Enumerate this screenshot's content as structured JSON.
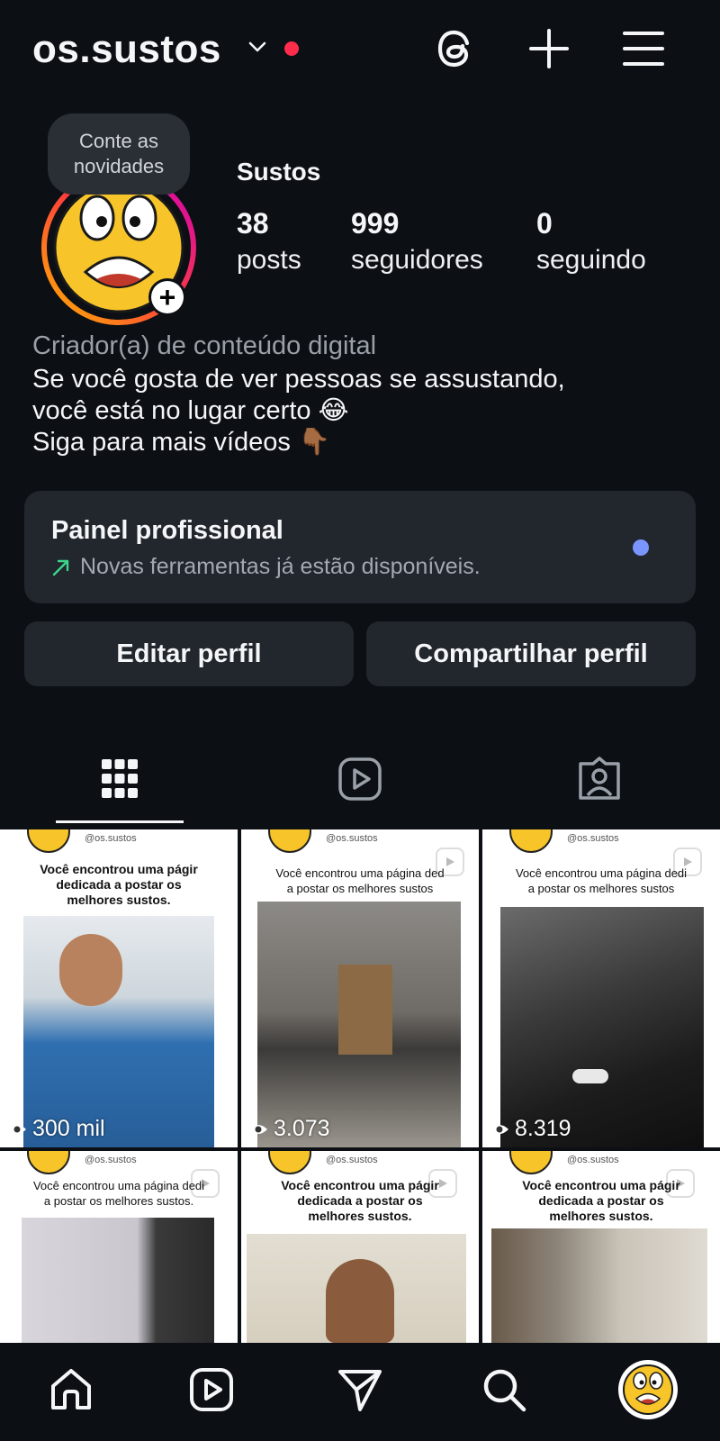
{
  "header": {
    "username": "os.sustos",
    "icons": [
      "threads-icon",
      "plus-icon",
      "menu-icon"
    ]
  },
  "profile": {
    "note": [
      "Conte as",
      "novidades"
    ],
    "name": "Sustos",
    "stats": [
      {
        "value": "38",
        "label": "posts"
      },
      {
        "value": "999",
        "label": "seguidores"
      },
      {
        "value": "0",
        "label": "seguindo"
      }
    ],
    "category": "Criador(a) de conteúdo digital",
    "bio": [
      "Se você gosta de ver pessoas se assustando,",
      "você está no lugar certo 😂",
      "Siga para mais vídeos 👇🏾"
    ]
  },
  "painel": {
    "title": "Painel profissional",
    "subtitle": "Novas ferramentas já estão disponíveis."
  },
  "buttons": {
    "edit": "Editar perfil",
    "share": "Compartilhar perfil"
  },
  "tabs": [
    "grid-icon",
    "reels-icon",
    "tagged-icon"
  ],
  "grid": {
    "handle": "@os.sustos",
    "posts": [
      {
        "caption": [
          "Você encontrou uma págir",
          "dedicada a postar os",
          "melhores sustos."
        ],
        "views": "300 mil"
      },
      {
        "caption": [
          "Você encontrou uma página ded",
          "a postar os melhores sustos"
        ],
        "views": "3.073"
      },
      {
        "caption": [
          "Você encontrou uma página dedi",
          "a postar os melhores sustos"
        ],
        "views": "8.319"
      },
      {
        "caption": [
          "Você encontrou uma página dedi",
          "a postar os melhores sustos."
        ],
        "views": ""
      },
      {
        "caption": [
          "Você encontrou uma págir",
          "dedicada a postar os",
          "melhores sustos."
        ],
        "views": ""
      },
      {
        "caption": [
          "Você encontrou uma págir",
          "dedicada a postar os",
          "melhores sustos."
        ],
        "views": ""
      }
    ]
  },
  "bottom_nav": [
    "home-icon",
    "reels-icon",
    "send-icon",
    "search-icon",
    "profile-avatar"
  ],
  "colors": {
    "background": "#0c0f14",
    "card": "#22262d",
    "notification_dot": "#ff2d4b",
    "painel_dot": "#7a95ff",
    "trend_arrow": "#3dd68c"
  }
}
